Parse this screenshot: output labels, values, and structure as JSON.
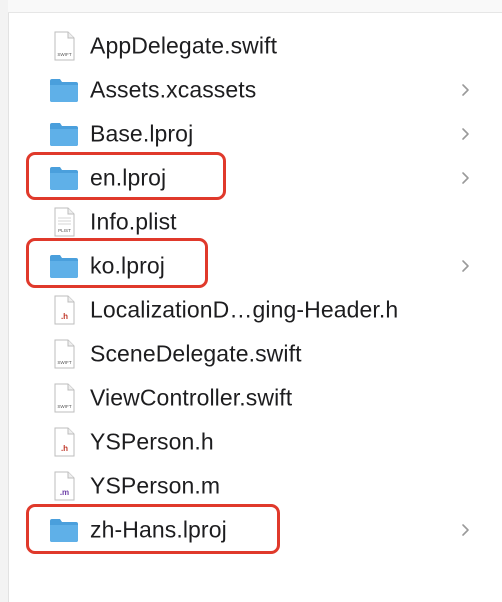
{
  "files": [
    {
      "name": "AppDelegate.swift",
      "icon": "swift-file-icon",
      "tag": "SWIFT",
      "folder": false
    },
    {
      "name": "Assets.xcassets",
      "icon": "folder-icon",
      "folder": true
    },
    {
      "name": "Base.lproj",
      "icon": "folder-icon",
      "folder": true
    },
    {
      "name": "en.lproj",
      "icon": "folder-icon",
      "folder": true,
      "highlighted": true
    },
    {
      "name": "Info.plist",
      "icon": "plist-file-icon",
      "tag": "PLIST",
      "folder": false
    },
    {
      "name": "ko.lproj",
      "icon": "folder-icon",
      "folder": true,
      "highlighted": true
    },
    {
      "name": "LocalizationD…ging-Header.h",
      "icon": "h-file-icon",
      "tag": ".h",
      "folder": false
    },
    {
      "name": "SceneDelegate.swift",
      "icon": "swift-file-icon",
      "tag": "SWIFT",
      "folder": false
    },
    {
      "name": "ViewController.swift",
      "icon": "swift-file-icon",
      "tag": "SWIFT",
      "folder": false
    },
    {
      "name": "YSPerson.h",
      "icon": "h-file-icon",
      "tag": ".h",
      "folder": false
    },
    {
      "name": "YSPerson.m",
      "icon": "m-file-icon",
      "tag": ".m",
      "folder": false
    },
    {
      "name": "zh-Hans.lproj",
      "icon": "folder-icon",
      "folder": true,
      "highlighted": true
    }
  ],
  "colors": {
    "highlight": "#e0392b",
    "folder_front": "#5fb0e8",
    "folder_back": "#4a9fdc",
    "h_tag": "#c0392b",
    "m_tag": "#6d3fa8"
  }
}
